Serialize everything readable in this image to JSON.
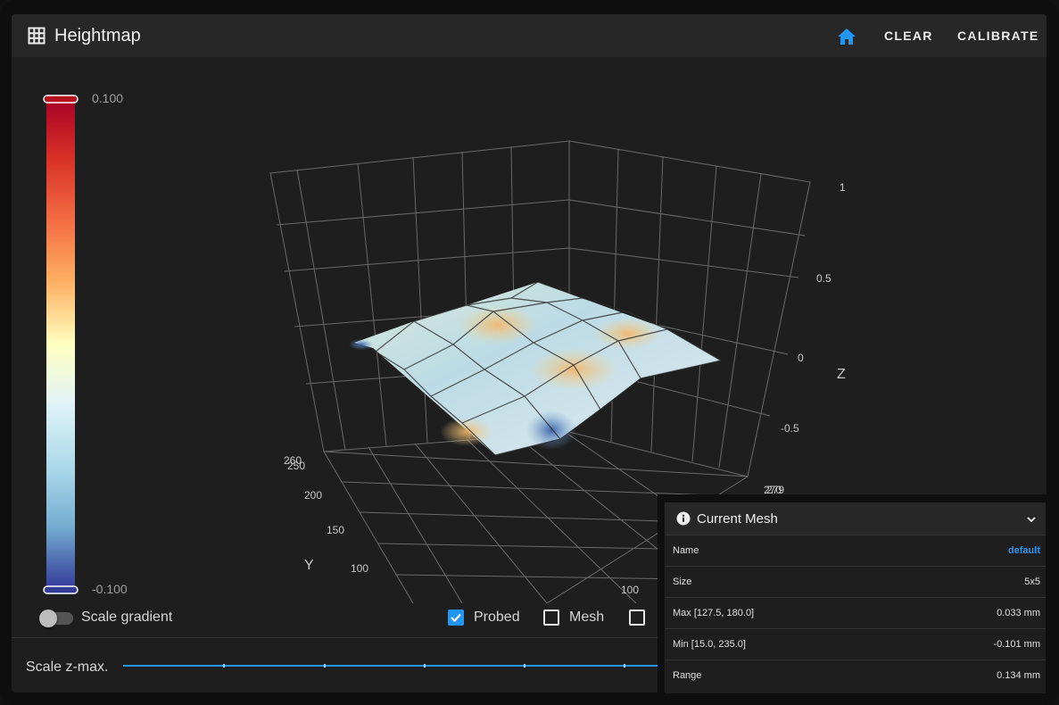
{
  "header": {
    "title": "Heightmap",
    "clear_label": "CLEAR",
    "calibrate_label": "CALIBRATE",
    "icons": {
      "title": "grid-icon",
      "home": "home-icon"
    },
    "accent": "#2196f3"
  },
  "colorbar": {
    "max_label": "0.100",
    "min_label": "-0.100"
  },
  "axes": {
    "z_label": "Z",
    "y_label": "Y",
    "z_ticks": [
      "1",
      "0.5",
      "0",
      "-0.5"
    ],
    "y_ticks": [
      "260",
      "250",
      "200",
      "150",
      "100"
    ],
    "x_ticks": [
      "279",
      "270",
      "250",
      "100"
    ]
  },
  "controls": {
    "scale_gradient_label": "Scale gradient",
    "probed_label": "Probed",
    "mesh_label": "Mesh",
    "scale_zmax_label": "Scale z-max."
  },
  "mesh_panel": {
    "title": "Current Mesh",
    "rows": [
      {
        "key": "Name",
        "value": "default"
      },
      {
        "key": "Size",
        "value": "5x5"
      },
      {
        "key": "Max [127.5, 180.0]",
        "value": "0.033 mm"
      },
      {
        "key": "Min [15.0, 235.0]",
        "value": "-0.101 mm"
      },
      {
        "key": "Range",
        "value": "0.134 mm"
      }
    ]
  }
}
